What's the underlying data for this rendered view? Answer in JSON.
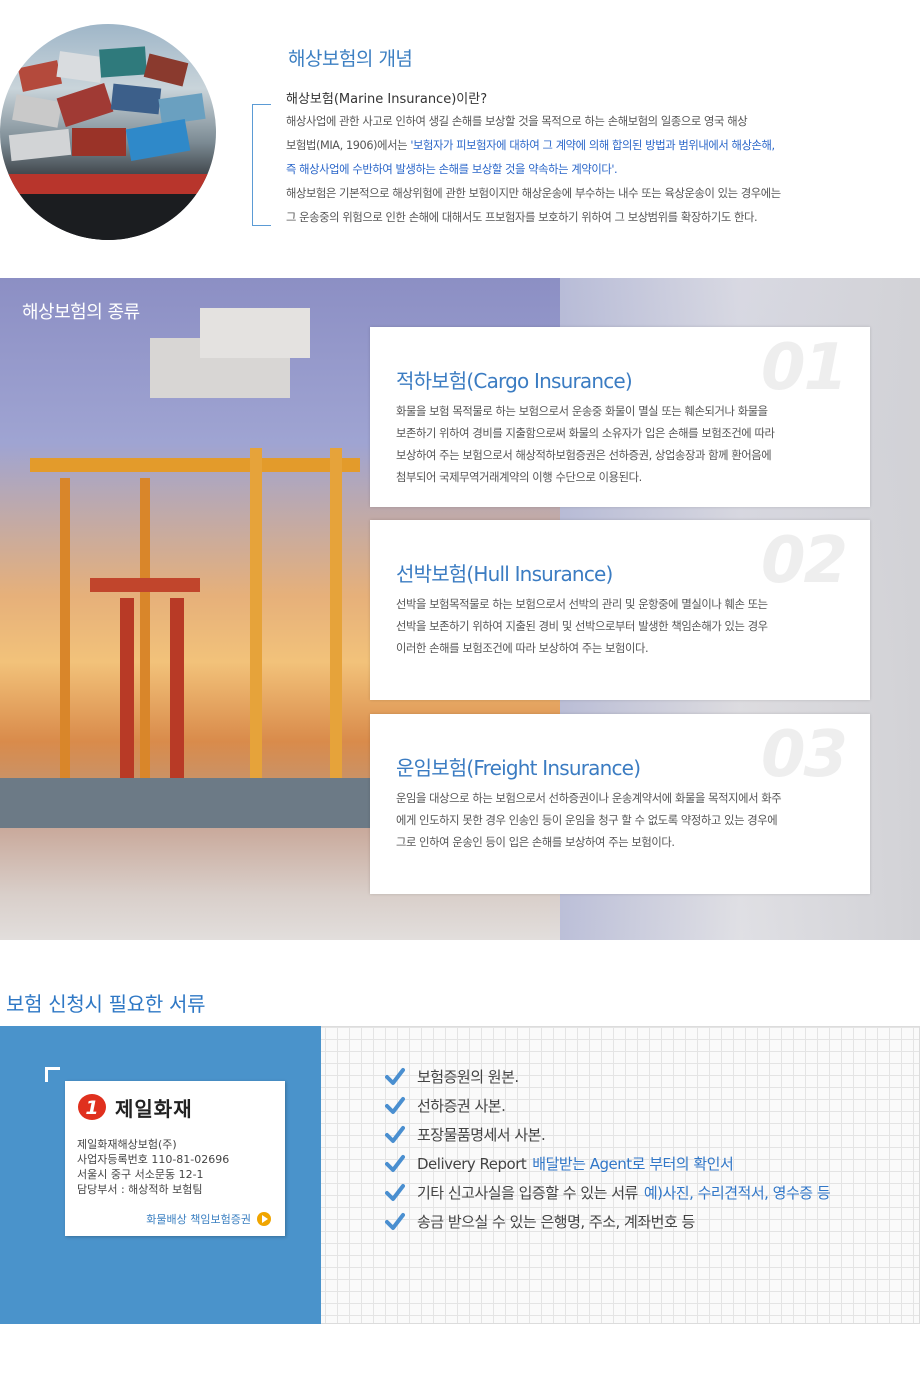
{
  "intro": {
    "title": "해상보험의 개념",
    "subtitle": "해상보험(Marine Insurance)이란?",
    "line1": "해상사업에 관한 사고로 인하여 생길 손해를 보상할 것을 목적으로 하는 손해보험의 일종으로 영국 해상",
    "line2_prefix": "보험법(MIA, 1906)에서는 ",
    "line2_highlight": "'보험자가 피보험자에 대하여 그 계약에 의해 합의된 방법과 범위내에서 해상손해,",
    "line3_highlight": "즉 해상사업에 수반하여 발생하는 손해를 보상할 것을 약속하는 계약이다'.",
    "line4": "해상보험은 기본적으로 해상위험에 관한 보험이지만 해상운송에 부수하는 내수 또는 육상운송이 있는 경우에는",
    "line5": "그 운송중의 위험으로 인한 손해에 대해서도 프보험자를 보호하기 위하여 그 보상범위를 확장하기도 한다."
  },
  "types": {
    "title": "해상보험의 종류",
    "cards": [
      {
        "num": "01",
        "title": "적하보험(Cargo Insurance)",
        "lines": [
          "화물을 보험 목적물로 하는 보험으로서 운송중 화물이 멸실 또는 훼손되거나 화물을",
          "보존하기 위하여 경비를 지출함으로써 화물의 소유자가 입은 손해를 보험조건에 따라",
          "보상하여 주는 보험으로서 해상적하보험증권은 선하증권, 상업송장과 함께 환어음에",
          "첨부되어 국제무역거래계약의 이행 수단으로 이용된다."
        ]
      },
      {
        "num": "02",
        "title": "선박보험(Hull Insurance)",
        "lines": [
          "선박을 보험목적물로 하는 보험으로서 선박의 관리 및 운항중에 멸실이나 훼손 또는",
          "선박을 보존하기 위하여 지출된 경비 및 선박으로부터 발생한 책임손해가 있는 경우",
          "이러한 손해를 보험조건에 따라 보상하여 주는 보험이다."
        ]
      },
      {
        "num": "03",
        "title": "운임보험(Freight Insurance)",
        "lines": [
          "운임을 대상으로 하는 보험으로서 선하증권이나 운송계약서에 화물을 목적지에서 화주",
          "에게 인도하지 못한 경우 인송인 등이 운임을 청구 할 수 없도록 약정하고 있는 경우에",
          "그로 인하여 운송인 등이 입은 손해를 보상하여 주는 보험이다."
        ]
      }
    ]
  },
  "docs": {
    "title": "보험 신청시 필요한 서류",
    "company": {
      "logo_text": "제일화재",
      "logo_num": "1",
      "info_lines": [
        "제일화재해상보험(주)",
        "사업자등록번호 110-81-02696",
        "서울시 중구 서소문동 12-1",
        "담당부서 : 해상적하 보험팀"
      ],
      "link_label": "화물배상 책임보험증권"
    },
    "items": [
      {
        "text": "보험증원의 원본.",
        "note": ""
      },
      {
        "text": "선하증권 사본.",
        "note": ""
      },
      {
        "text": "포장물품명세서 사본.",
        "note": ""
      },
      {
        "text": "Delivery Report",
        "note": "배달받는 Agent로 부터의 확인서"
      },
      {
        "text": "기타 신고사실을 입증할 수 있는 서류",
        "note": "예)사진, 수리견적서, 영수증 등"
      },
      {
        "text": "송금 받으실 수 있는 은행명, 주소, 계좌번호 등",
        "note": ""
      }
    ]
  },
  "colors": {
    "accent": "#3b7cc2",
    "panel": "#4a93cb",
    "check": "#4a8fd0"
  }
}
